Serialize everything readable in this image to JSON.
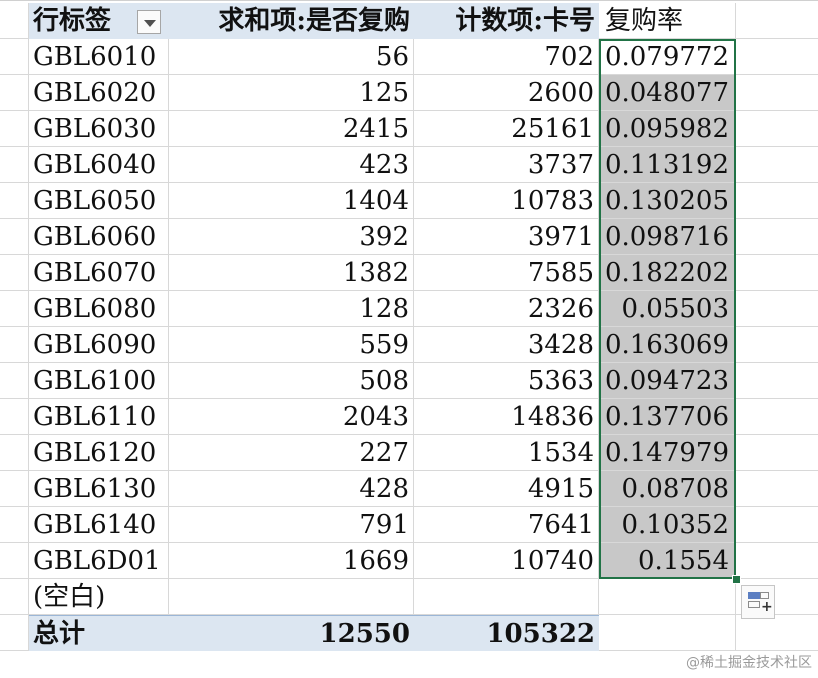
{
  "pivot": {
    "header": {
      "row_label": "行标签",
      "sum_label": "求和项:是否复购",
      "count_label": "计数项:卡号",
      "rate_label": "复购率"
    },
    "rows": [
      {
        "label": "GBL6010",
        "sum": "56",
        "count": "702",
        "rate": "0.079772"
      },
      {
        "label": "GBL6020",
        "sum": "125",
        "count": "2600",
        "rate": "0.048077"
      },
      {
        "label": "GBL6030",
        "sum": "2415",
        "count": "25161",
        "rate": "0.095982"
      },
      {
        "label": "GBL6040",
        "sum": "423",
        "count": "3737",
        "rate": "0.113192"
      },
      {
        "label": "GBL6050",
        "sum": "1404",
        "count": "10783",
        "rate": "0.130205"
      },
      {
        "label": "GBL6060",
        "sum": "392",
        "count": "3971",
        "rate": "0.098716"
      },
      {
        "label": "GBL6070",
        "sum": "1382",
        "count": "7585",
        "rate": "0.182202"
      },
      {
        "label": "GBL6080",
        "sum": "128",
        "count": "2326",
        "rate": "0.05503"
      },
      {
        "label": "GBL6090",
        "sum": "559",
        "count": "3428",
        "rate": "0.163069"
      },
      {
        "label": "GBL6100",
        "sum": "508",
        "count": "5363",
        "rate": "0.094723"
      },
      {
        "label": "GBL6110",
        "sum": "2043",
        "count": "14836",
        "rate": "0.137706"
      },
      {
        "label": "GBL6120",
        "sum": "227",
        "count": "1534",
        "rate": "0.147979"
      },
      {
        "label": "GBL6130",
        "sum": "428",
        "count": "4915",
        "rate": "0.08708"
      },
      {
        "label": "GBL6140",
        "sum": "791",
        "count": "7641",
        "rate": "0.10352"
      },
      {
        "label": "GBL6D01",
        "sum": "1669",
        "count": "10740",
        "rate": "0.1554"
      }
    ],
    "blank_label": "(空白)",
    "total": {
      "label": "总计",
      "sum": "12550",
      "count": "105322"
    }
  },
  "watermark": "@稀土掘金技术社区",
  "colors": {
    "pivot_header_bg": "#dce6f1",
    "selection_border": "#217346",
    "selection_fill": "#c8c8c8"
  },
  "icons": {
    "filter_dropdown": "chevron-down-icon",
    "quick_analysis": "quick-analysis-icon"
  }
}
